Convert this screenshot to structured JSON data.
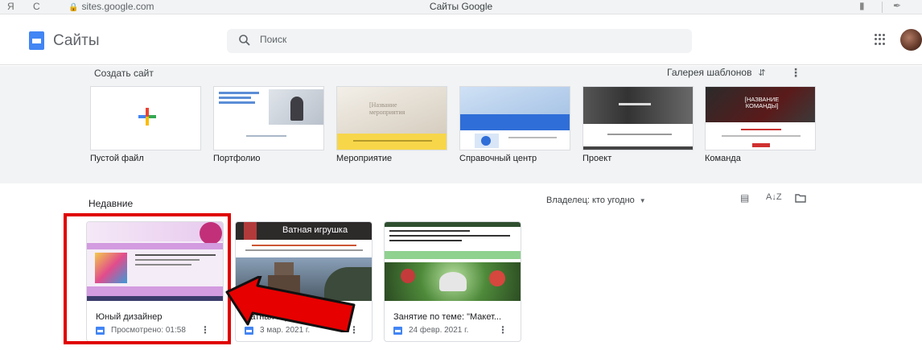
{
  "browser": {
    "back_glyph": "Я",
    "reload_glyph": "C",
    "url": "sites.google.com",
    "title": "Сайты Google"
  },
  "header": {
    "app_title": "Сайты",
    "search_placeholder": "Поиск"
  },
  "gallery": {
    "heading": "Создать сайт",
    "switch_label": "Галерея шаблонов",
    "templates": [
      {
        "label": "Пустой файл"
      },
      {
        "label": "Портфолио"
      },
      {
        "label": "Мероприятие",
        "thumb_text": "[Название мероприятия"
      },
      {
        "label": "Справочный центр"
      },
      {
        "label": "Проект"
      },
      {
        "label": "Команда",
        "thumb_text": "[НАЗВАНИЕ КОМАНДЫ]"
      }
    ]
  },
  "recent": {
    "heading": "Недавние",
    "owner_filter": "Владелец: кто угодно",
    "cards": [
      {
        "title": "Юный дизайнер",
        "meta": "Просмотрено: 01:58"
      },
      {
        "title": "Ватная игрушка",
        "meta": "3 мар. 2021 г.",
        "thumb_title": "Ватная игрушка"
      },
      {
        "title": "Занятие по теме: \"Макет...",
        "meta": "24 февр. 2021 г."
      }
    ]
  },
  "colors": {
    "accent": "#4285f4",
    "highlight": "#e00000",
    "arrow": "#e00000"
  }
}
